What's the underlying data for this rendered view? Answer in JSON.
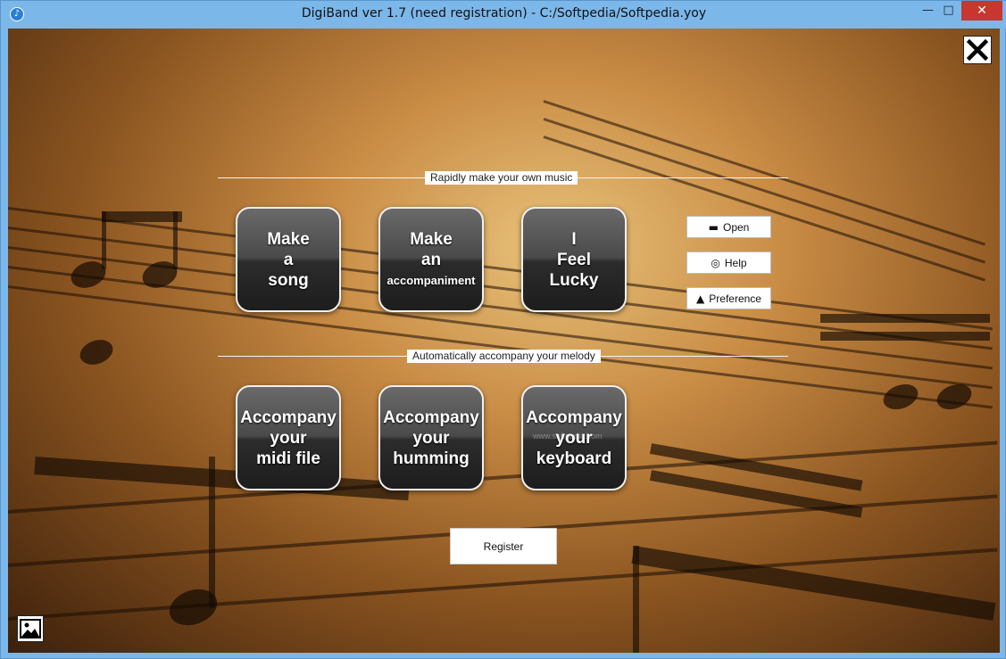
{
  "window": {
    "title": "DigiBand ver 1.7  (need registration)  -  C:/Softpedia/Softpedia.yoy",
    "icon": "app-icon",
    "min_glyph": "—",
    "max_glyph": "□",
    "close_glyph": "✕"
  },
  "sections": {
    "top_label": "Rapidly make your own music",
    "bottom_label": "Automatically accompany your melody"
  },
  "top_buttons": [
    {
      "lines": [
        "Make",
        "a",
        "song"
      ]
    },
    {
      "lines": [
        "Make",
        "an",
        "accompaniment"
      ]
    },
    {
      "lines": [
        "I",
        "Feel",
        "Lucky"
      ]
    }
  ],
  "bottom_buttons": [
    {
      "lines": [
        "Accompany",
        "your",
        "midi file"
      ]
    },
    {
      "lines": [
        "Accompany",
        "your",
        "humming"
      ]
    },
    {
      "lines": [
        "Accompany",
        "your",
        "keyboard"
      ]
    }
  ],
  "side_buttons": {
    "open": {
      "label": "Open",
      "icon": "folder-icon",
      "glyph": "▬"
    },
    "help": {
      "label": "Help",
      "icon": "lifebuoy-icon",
      "glyph": "◎"
    },
    "preference": {
      "label": "Preference",
      "icon": "cone-icon",
      "glyph": "▲"
    }
  },
  "register_label": "Register",
  "watermark": "www.softpedia.com",
  "colors": {
    "close_button": "#c7372f",
    "titlebar": "#7cb7ea"
  }
}
